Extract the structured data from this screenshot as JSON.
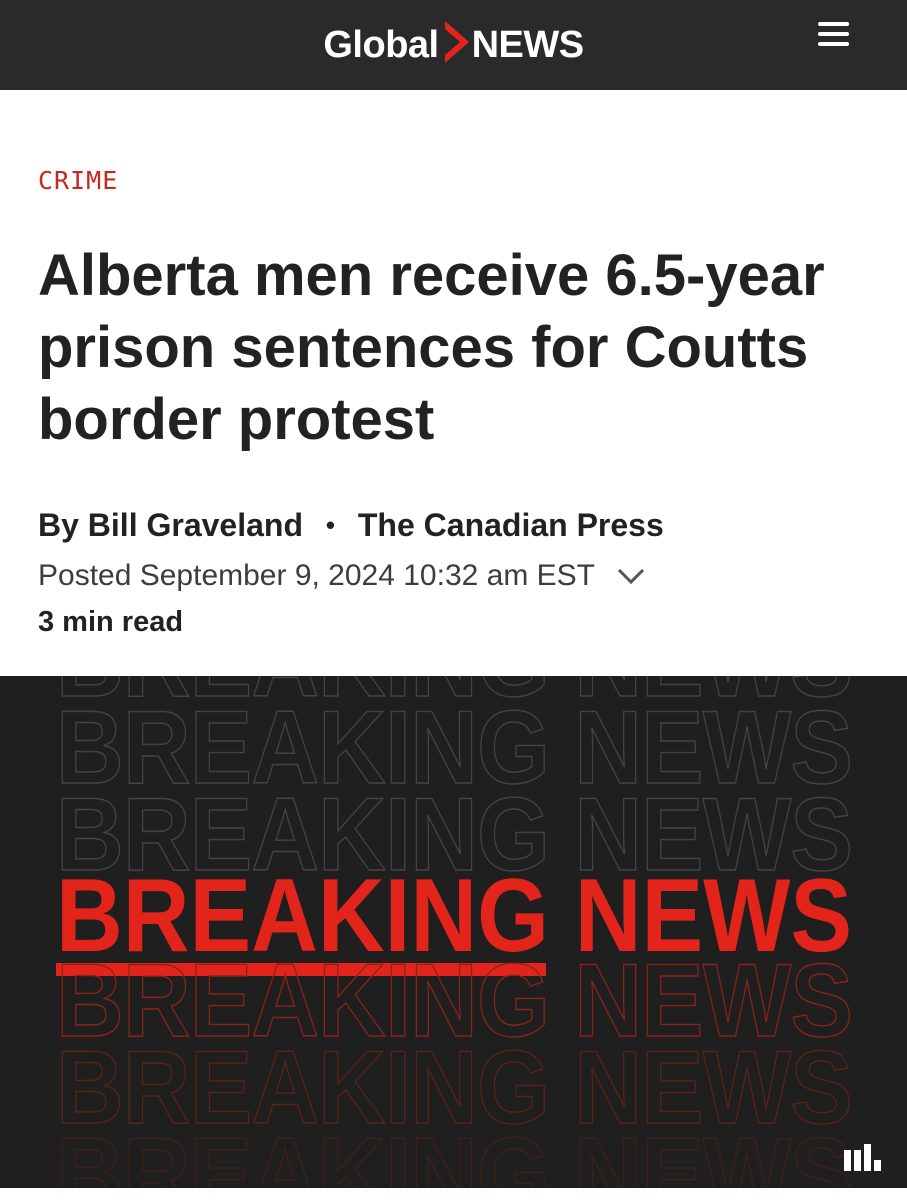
{
  "header": {
    "logo_word_1": "Global",
    "logo_word_2": "NEWS",
    "brand_color": "#e3241b",
    "menu_icon": "hamburger-menu-icon"
  },
  "article": {
    "category": "CRIME",
    "category_color": "#c8281c",
    "headline": "Alberta men receive 6.5-year prison sentences for Coutts border protest",
    "byline_prefix": "By",
    "author": "Bill Graveland",
    "byline_separator": "•",
    "source": "The Canadian Press",
    "posted": "Posted September 9, 2024 10:32 am EST",
    "read_time": "3 min read"
  },
  "hero_image": {
    "headline_text": "BREAKING NEWS",
    "text_color": "#e3241b",
    "corner_icon": "media-bars-icon"
  }
}
